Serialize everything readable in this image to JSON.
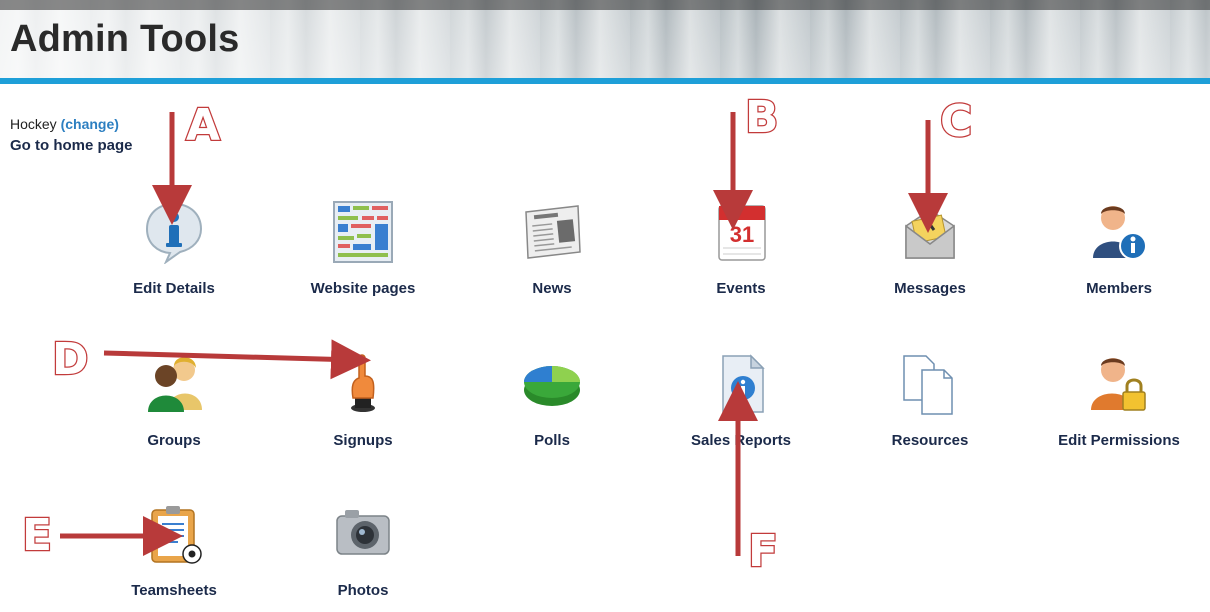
{
  "header": {
    "title": "Admin Tools",
    "accent_color": "#1e9fd8"
  },
  "context": {
    "sport": "Hockey",
    "change_label": "(change)",
    "home_link": "Go to home page"
  },
  "tools": [
    {
      "label": "Edit Details",
      "icon": "info-bubble-icon"
    },
    {
      "label": "Website pages",
      "icon": "website-layout-icon"
    },
    {
      "label": "News",
      "icon": "newspaper-icon"
    },
    {
      "label": "Events",
      "icon": "calendar-icon"
    },
    {
      "label": "Messages",
      "icon": "envelope-icon"
    },
    {
      "label": "Members",
      "icon": "member-info-icon"
    },
    {
      "label": "Groups",
      "icon": "group-people-icon"
    },
    {
      "label": "Signups",
      "icon": "raised-finger-icon"
    },
    {
      "label": "Polls",
      "icon": "pie-chart-icon"
    },
    {
      "label": "Sales Reports",
      "icon": "report-document-icon"
    },
    {
      "label": "Resources",
      "icon": "documents-icon"
    },
    {
      "label": "Edit Permissions",
      "icon": "user-lock-icon"
    },
    {
      "label": "Teamsheets",
      "icon": "clipboard-ball-icon"
    },
    {
      "label": "Photos",
      "icon": "camera-icon"
    }
  ],
  "annotations": [
    "A",
    "B",
    "C",
    "D",
    "E",
    "F"
  ],
  "annotation_color": "#c23b3b"
}
